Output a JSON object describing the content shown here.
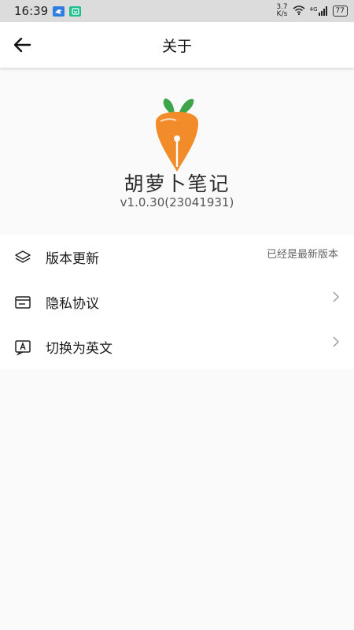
{
  "status_bar": {
    "time": "16:39",
    "net_speed_value": "3.7",
    "net_speed_unit": "K/s",
    "signal": "4G",
    "battery": "77"
  },
  "header": {
    "title": "关于"
  },
  "app": {
    "name": "胡萝卜笔记",
    "version": "v1.0.30(23041931)"
  },
  "menu": {
    "items": [
      {
        "label": "版本更新",
        "right_text": "已经是最新版本",
        "icon": "layers-icon"
      },
      {
        "label": "隐私协议",
        "icon": "document-icon"
      },
      {
        "label": "切换为英文",
        "icon": "language-icon"
      }
    ]
  },
  "colors": {
    "carrot": "#f28c2b",
    "leaf": "#3ea44a",
    "background": "#fafafa"
  }
}
